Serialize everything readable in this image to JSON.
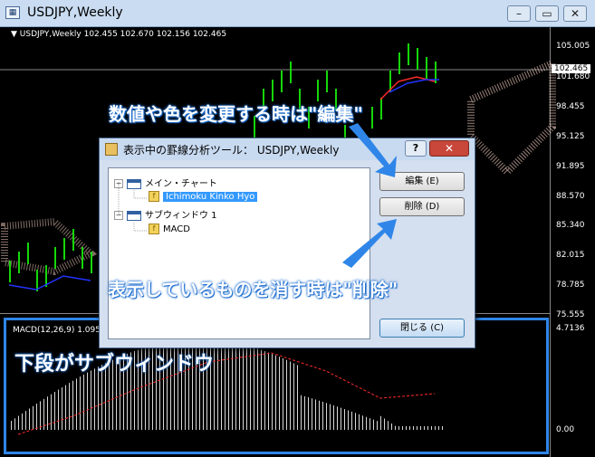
{
  "window": {
    "title": "USDJPY,Weekly",
    "buttons": {
      "minimize": "–",
      "restore": "▭",
      "close": "✕"
    }
  },
  "chart": {
    "info_line": "▼ USDJPY,Weekly  102.455 102.670 102.156 102.465",
    "price_axis": [
      "105.005",
      "101.680",
      "98.455",
      "95.125",
      "91.895",
      "88.570",
      "85.340",
      "82.015",
      "78.785",
      "75.555"
    ],
    "current_price": "102.465",
    "sub_window_label": "MACD(12,26,9) 1.095",
    "sub_axis": [
      "4.7136",
      "0.00"
    ],
    "colors": {
      "candles": "#16d60a",
      "red_line": "#ff2a2a",
      "blue_line": "#2233ff",
      "cloud": "#ffd7c8",
      "macd_hist": "#ffffff",
      "signal": "#ff2a2a",
      "accent": "#2f86e8"
    }
  },
  "dialog": {
    "title": "表示中の罫線分析ツール： USDJPY,Weekly",
    "help": "?",
    "close_x": "✕",
    "tree": {
      "main_chart": "メイン・チャート",
      "main_indicator": "Ichimoku Kinko Hyo",
      "sub_window": "サブウィンドウ 1",
      "sub_indicator": "MACD"
    },
    "edit_button": "編集 (E)",
    "delete_button": "削除 (D)",
    "close_button": "閉じる (C)"
  },
  "annotations": {
    "edit_note": "数値や色を変更する時は\"編集\"",
    "delete_note": "表示しているものを消す時は\"削除\"",
    "sub_window_note": "下段がサブウィンドウ"
  }
}
